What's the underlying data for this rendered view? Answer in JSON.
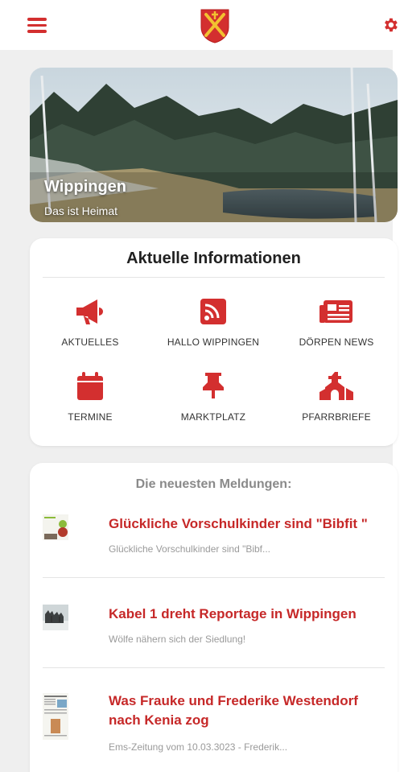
{
  "colors": {
    "accent": "#d32f2f",
    "title_red": "#c62828",
    "muted": "#9a9a9a"
  },
  "header": {
    "menu_icon": "hamburger-menu-icon",
    "logo": "crest-icon",
    "settings_icon": "gear-icon"
  },
  "hero": {
    "title": "Wippingen",
    "subtitle": "Das ist Heimat"
  },
  "info": {
    "title": "Aktuelle Informationen",
    "tiles": [
      {
        "label": "AKTUELLES",
        "icon": "megaphone-icon"
      },
      {
        "label": "HALLO WIPPINGEN",
        "icon": "rss-icon"
      },
      {
        "label": "DÖRPEN NEWS",
        "icon": "newspaper-icon"
      },
      {
        "label": "TERMINE",
        "icon": "calendar-icon"
      },
      {
        "label": "MARKTPLATZ",
        "icon": "pushpin-icon"
      },
      {
        "label": "PFARRBRIEFE",
        "icon": "church-icon"
      }
    ]
  },
  "news": {
    "heading": "Die neuesten Meldungen:",
    "items": [
      {
        "title": "Glückliche Vorschulkinder sind \"Bibfit \"",
        "subtitle": "Glückliche Vorschulkinder sind \"Bibf..."
      },
      {
        "title": "Kabel 1 dreht Reportage in Wippingen",
        "subtitle": "Wölfe nähern sich der Siedlung!"
      },
      {
        "title": "Was Frauke und Frederike Westendorf nach Kenia zog",
        "subtitle": "Ems-Zeitung vom 10.03.3023 - Frederik..."
      }
    ]
  }
}
